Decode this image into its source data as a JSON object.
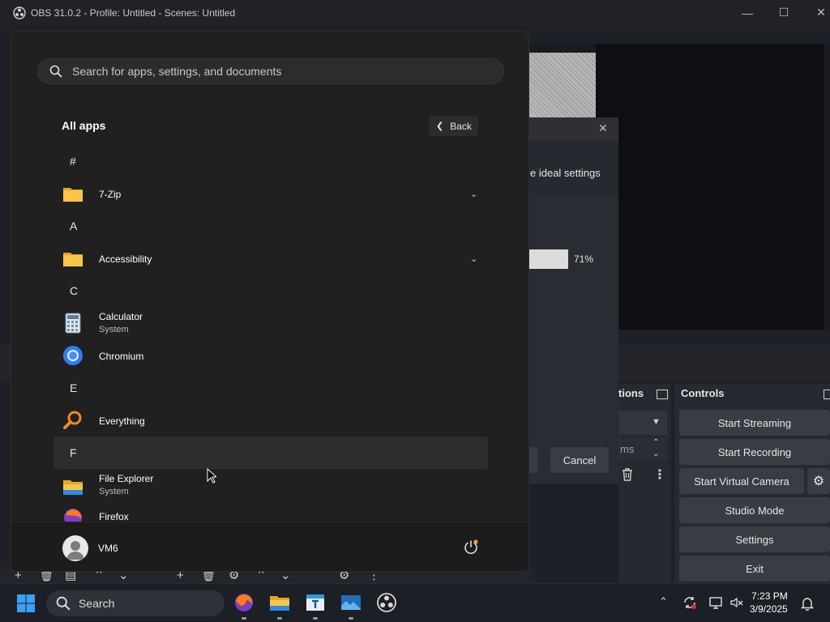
{
  "obs": {
    "window_title": "OBS 31.0.2 - Profile: Untitled - Scenes: Untitled",
    "wizard": {
      "text_fragment": "e ideal settings",
      "progress_percent": "71%",
      "progress_value": 71,
      "cancel_label": "Cancel"
    },
    "transitions_dock": {
      "title_fragment": "tions",
      "duration_fragment": "ms"
    },
    "controls_dock": {
      "title": "Controls",
      "buttons": {
        "start_streaming": "Start Streaming",
        "start_recording": "Start Recording",
        "start_virtual_camera": "Start Virtual Camera",
        "studio_mode": "Studio Mode",
        "settings": "Settings",
        "exit": "Exit"
      }
    }
  },
  "start_menu": {
    "search_placeholder": "Search for apps, settings, and documents",
    "section_title": "All apps",
    "back_label": "Back",
    "list": {
      "hash": "#",
      "seven_zip": "7-Zip",
      "a": "A",
      "accessibility": "Accessibility",
      "c": "C",
      "calculator": "Calculator",
      "calculator_sub": "System",
      "chromium": "Chromium",
      "e": "E",
      "everything": "Everything",
      "f": "F",
      "file_explorer": "File Explorer",
      "file_explorer_sub": "System",
      "firefox": "Firefox"
    },
    "user_name": "VM6"
  },
  "taskbar": {
    "search_label": "Search",
    "time": "7:23 PM",
    "date": "3/9/2025"
  },
  "colors": {
    "start_bg": "#202020",
    "obs_button": "#3a3c44",
    "taskbar_bg": "#1c1f26",
    "accent_blue": "#0078d4",
    "folder_yellow": "#f8c54a"
  },
  "icons": [
    "obs-logo-icon",
    "search-icon",
    "chevron-left-icon",
    "chevron-down-icon",
    "folder-icon",
    "calculator-icon",
    "chromium-icon",
    "everything-icon",
    "file-explorer-icon",
    "firefox-icon",
    "power-icon",
    "windows-start-icon",
    "dock-float-icon",
    "trash-icon",
    "kebab-icon",
    "gear-icon",
    "tray-chevron-icon",
    "sync-icon",
    "network-icon",
    "notification-bell-icon"
  ]
}
